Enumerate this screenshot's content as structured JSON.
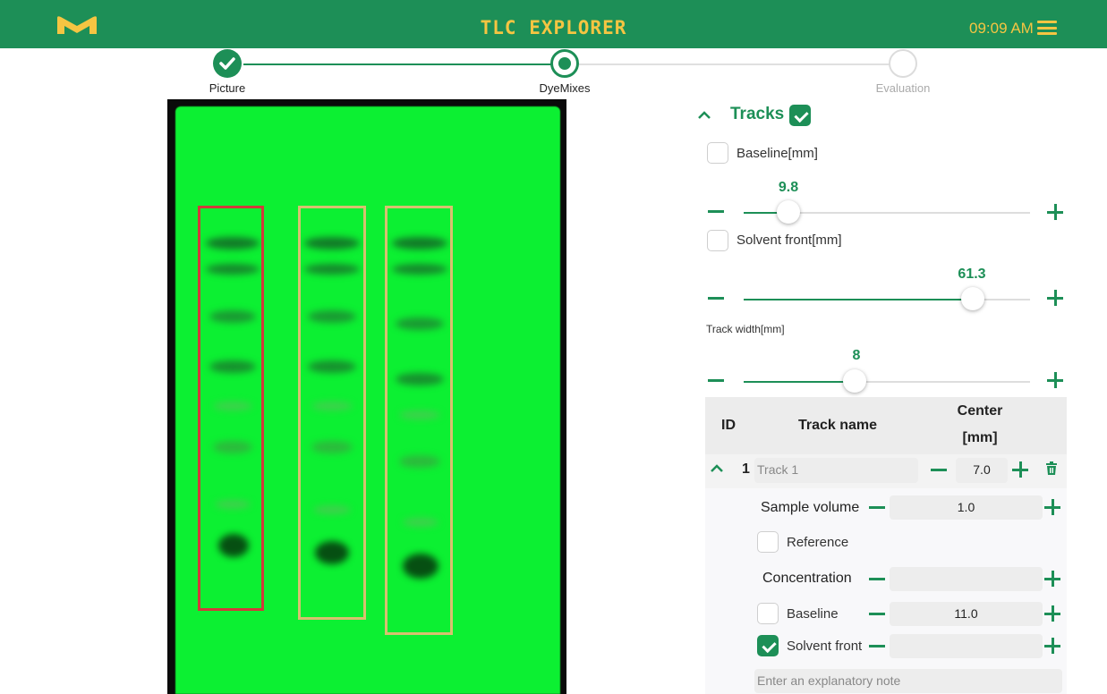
{
  "header": {
    "app_title": "TLC EXPLORER",
    "clock": "09:09 AM",
    "logo_icon": "m-logo-icon",
    "menu_icon": "hamburger-menu-icon",
    "colors": {
      "brand_green": "#1d8f57",
      "accent_yellow": "#f5c542"
    }
  },
  "stepper": {
    "steps": [
      {
        "label": "Picture",
        "state": "completed"
      },
      {
        "label": "DyeMixes",
        "state": "active"
      },
      {
        "label": "Evaluation",
        "state": "upcoming"
      }
    ]
  },
  "plate": {
    "plate_color": "#0cf032",
    "tracks": [
      {
        "id": 1,
        "box_color": "#d13a3a",
        "selected": true
      },
      {
        "id": 2,
        "box_color": "#d8c070",
        "selected": false
      },
      {
        "id": 3,
        "box_color": "#d8c070",
        "selected": false
      }
    ]
  },
  "tracks_panel": {
    "title": "Tracks",
    "enabled": true,
    "baseline": {
      "label": "Baseline[mm]",
      "checked": false,
      "value": "9.8"
    },
    "solvent_front": {
      "label": "Solvent front[mm]",
      "checked": false,
      "value": "61.3"
    },
    "track_width": {
      "label": "Track width[mm]",
      "value": "8"
    },
    "table": {
      "col_id": "ID",
      "col_name": "Track name",
      "col_center_line1": "Center",
      "col_center_line2": "[mm]",
      "rows": [
        {
          "id": "1",
          "name_placeholder": "Track 1",
          "center": "7.0",
          "sample_volume_label": "Sample volume",
          "sample_volume": "1.0",
          "reference_label": "Reference",
          "reference_checked": false,
          "concentration_label": "Concentration",
          "concentration": "",
          "baseline_label": "Baseline",
          "baseline_checked": false,
          "baseline_value": "11.0",
          "solvent_front_label": "Solvent front",
          "solvent_front_checked": true,
          "solvent_front_value": "",
          "note_placeholder": "Enter an explanatory note"
        }
      ]
    }
  }
}
